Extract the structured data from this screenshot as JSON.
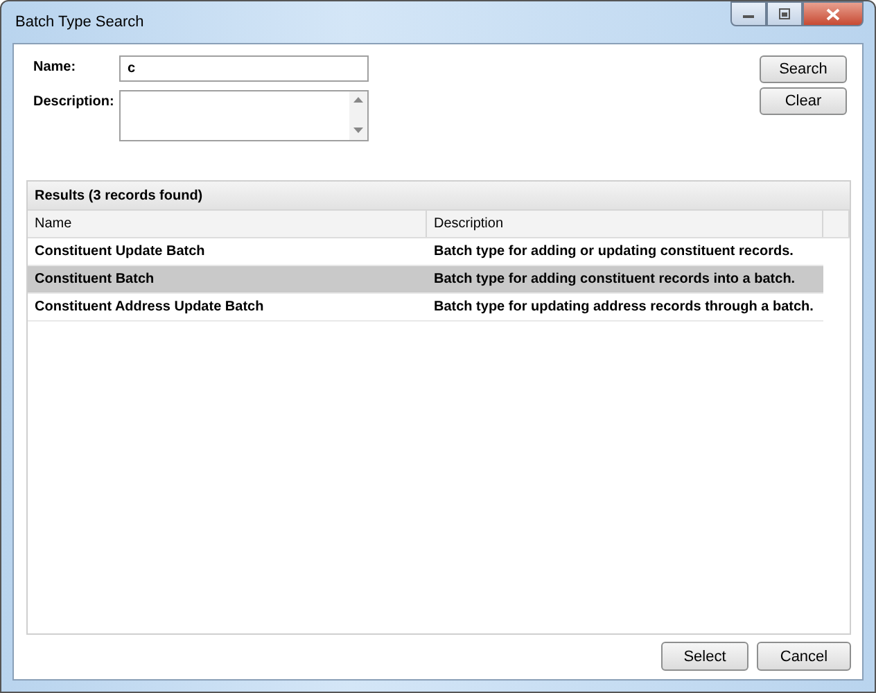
{
  "window": {
    "title": "Batch Type Search"
  },
  "form": {
    "name_label": "Name:",
    "name_value": "c",
    "description_label": "Description:"
  },
  "side_buttons": [
    "Search",
    "Clear"
  ],
  "results": {
    "title": "Results (3 records found)",
    "columns": [
      "Name",
      "Description"
    ],
    "rows": [
      {
        "cells": [
          "Constituent Update Batch",
          "Batch type for adding or updating constituent records."
        ],
        "selected": false
      },
      {
        "cells": [
          "Constituent Batch",
          "Batch type for adding constituent records into a batch."
        ],
        "selected": true
      },
      {
        "cells": [
          "Constituent Address Update Batch",
          "Batch type for updating address records through a batch."
        ],
        "selected": false
      }
    ]
  },
  "buttons": [
    "Select",
    "Cancel"
  ]
}
